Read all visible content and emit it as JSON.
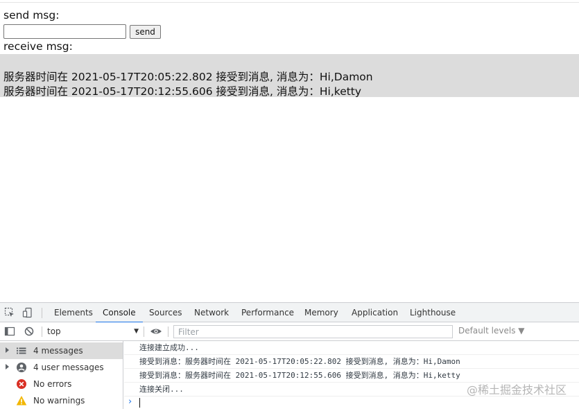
{
  "page": {
    "send_title": "send msg:",
    "input_value": "",
    "send_button": "send",
    "receive_title": "receive msg:",
    "received": [
      "服务器时间在 2021-05-17T20:05:22.802 接受到消息, 消息为：Hi,Damon",
      "服务器时间在 2021-05-17T20:12:55.606 接受到消息, 消息为：Hi,ketty"
    ]
  },
  "devtools": {
    "tabs": [
      "Elements",
      "Console",
      "Sources",
      "Network",
      "Performance",
      "Memory",
      "Application",
      "Lighthouse"
    ],
    "active_tab": "Console",
    "context": "top",
    "filter_placeholder": "Filter",
    "levels": "Default levels ▼",
    "sidebar": [
      {
        "label": "4 messages",
        "icon": "list-icon",
        "selected": true
      },
      {
        "label": "4 user messages",
        "icon": "user-icon",
        "selected": false
      },
      {
        "label": "No errors",
        "icon": "error-icon",
        "selected": false
      },
      {
        "label": "No warnings",
        "icon": "warning-icon",
        "selected": false
      }
    ],
    "console_lines": [
      "连接建立成功...",
      "接受到消息：服务器时间在 2021-05-17T20:05:22.802 接受到消息, 消息为：Hi,Damon",
      "接受到消息：服务器时间在 2021-05-17T20:12:55.606 接受到消息, 消息为：Hi,ketty",
      "连接关闭..."
    ],
    "prompt": "›"
  },
  "watermark": "@稀土掘金技术社区",
  "colors": {
    "accent": "#1a73e8",
    "error": "#d93025",
    "warning": "#f2b600",
    "receive_bg": "#dcdcdc"
  }
}
